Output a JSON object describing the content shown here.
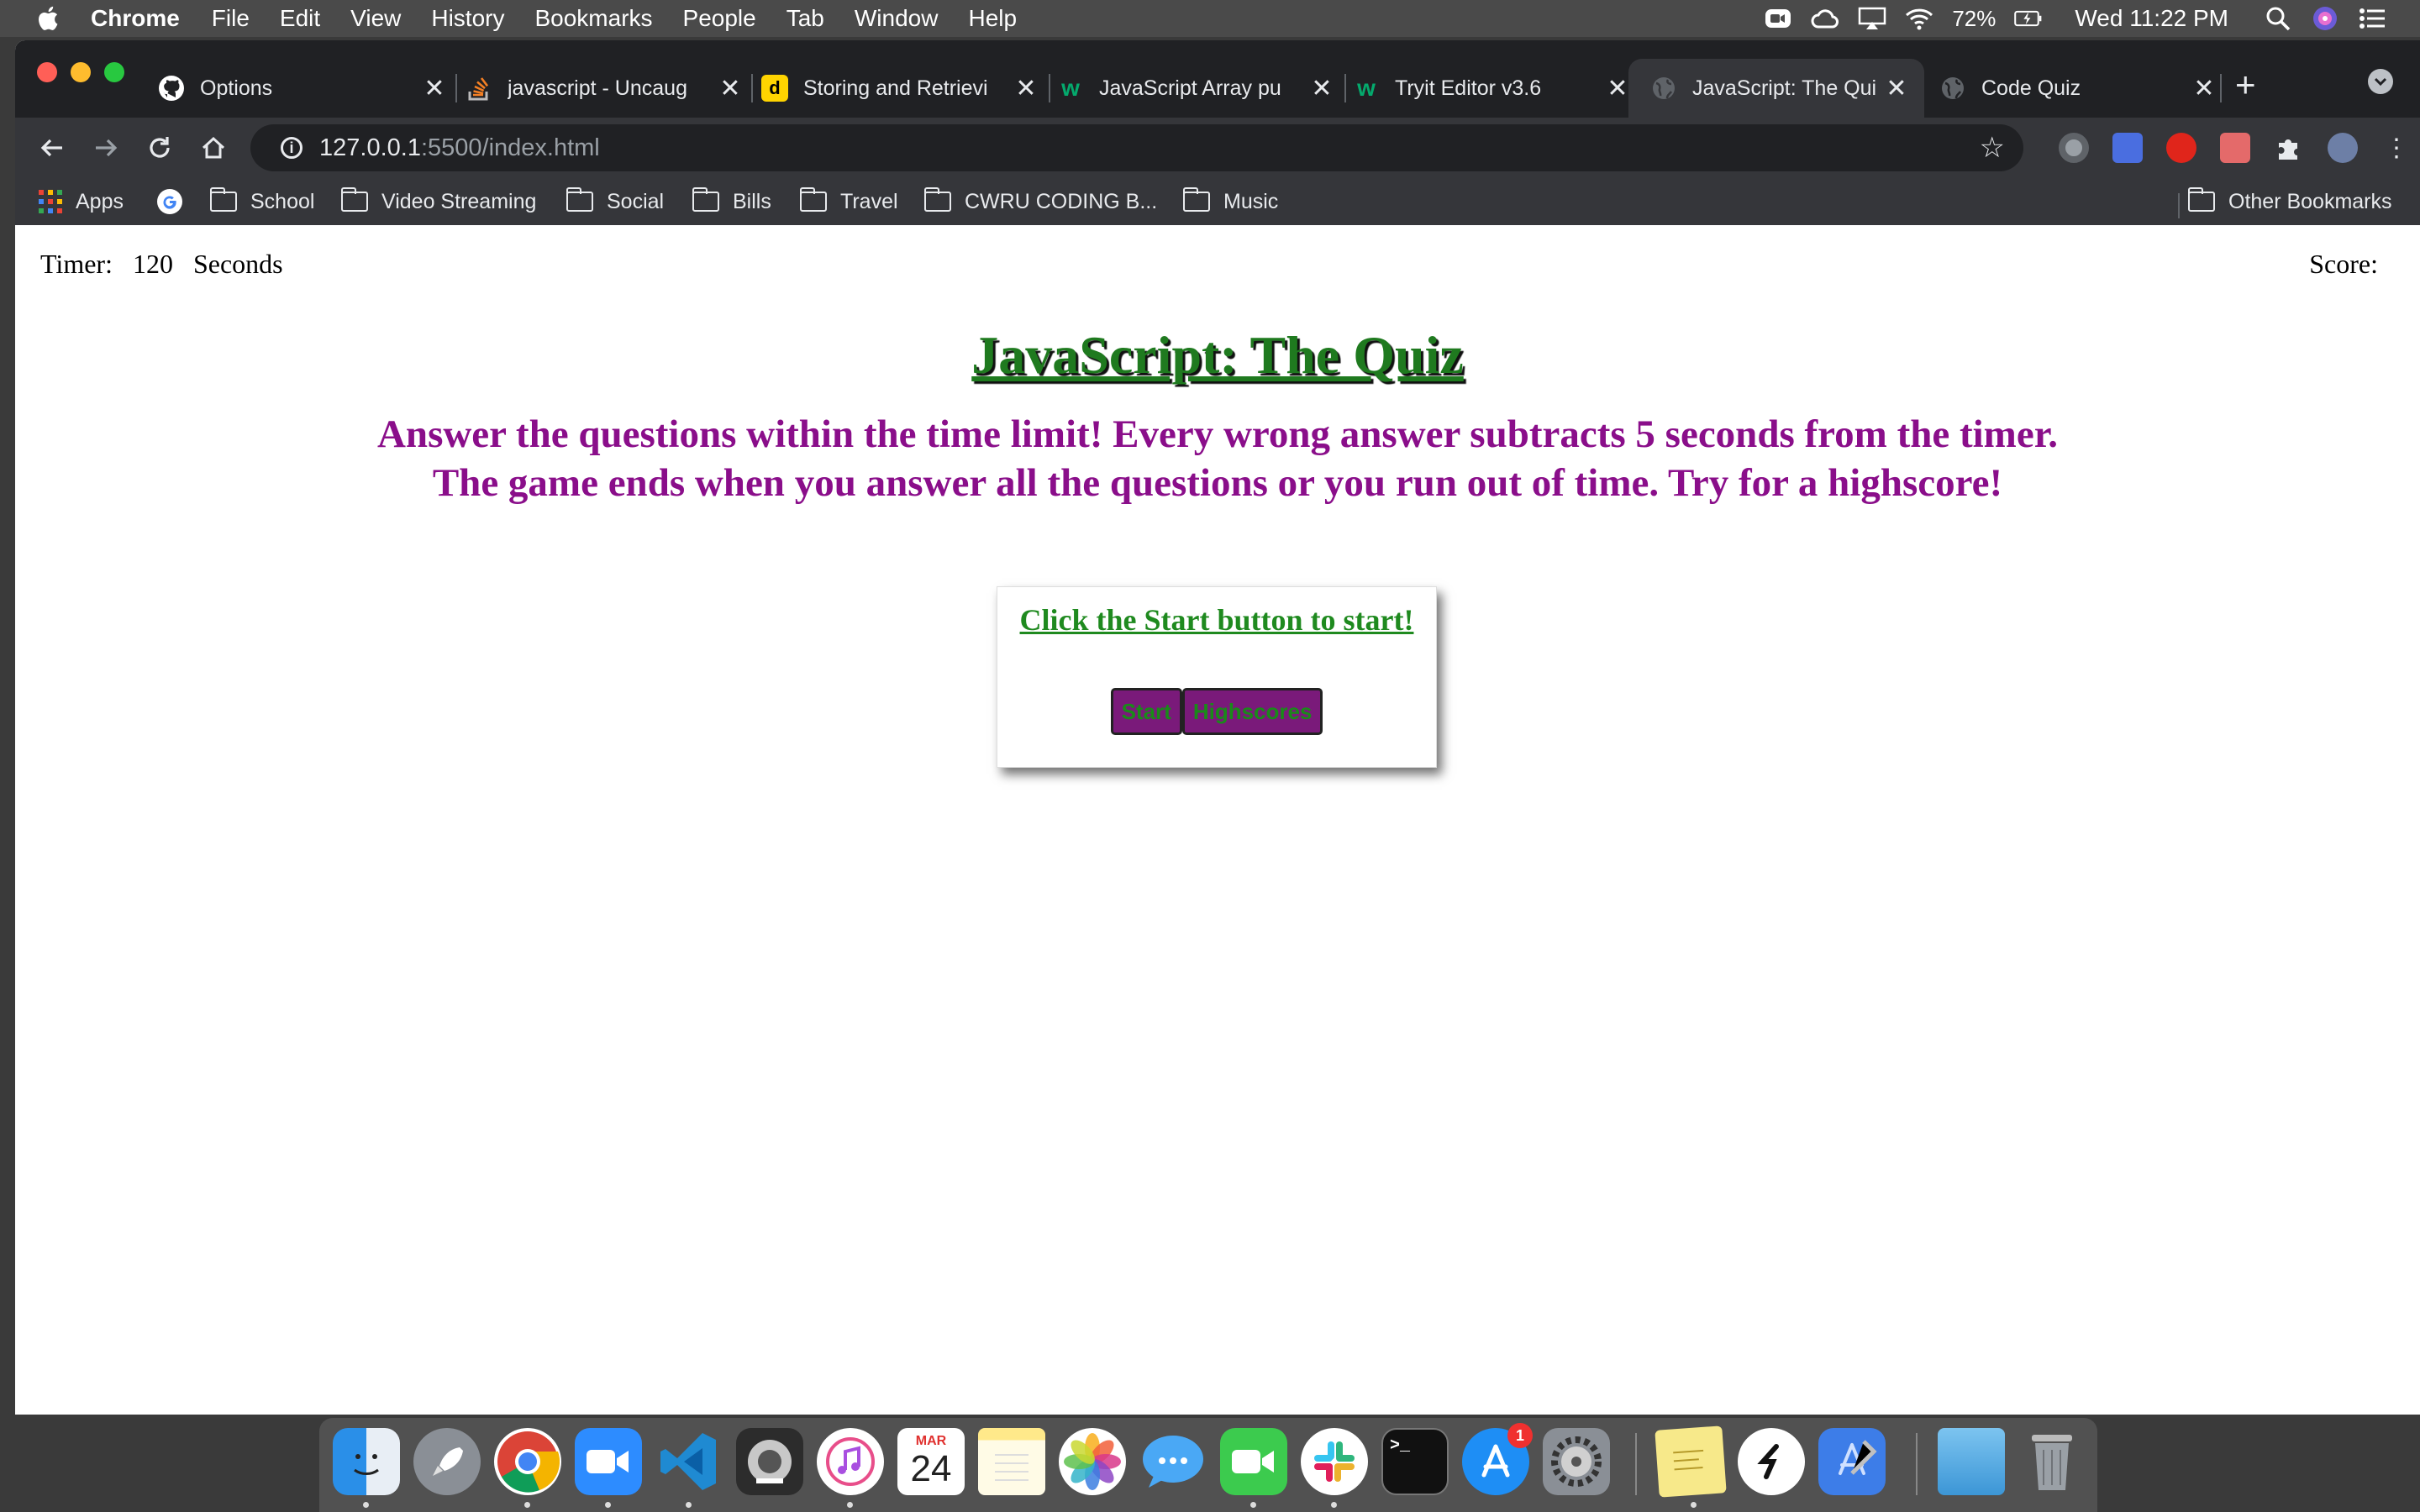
{
  "menubar": {
    "app": "Chrome",
    "items": [
      "File",
      "Edit",
      "View",
      "History",
      "Bookmarks",
      "People",
      "Tab",
      "Window",
      "Help"
    ],
    "battery": "72%",
    "clock": "Wed 11:22 PM"
  },
  "tabs": [
    {
      "title": "Options",
      "icon": "github-icon"
    },
    {
      "title": "javascript - Uncaug",
      "icon": "stackoverflow-icon"
    },
    {
      "title": "Storing and Retrievi",
      "icon": "dev-icon"
    },
    {
      "title": "JavaScript Array pu",
      "icon": "w3schools-icon"
    },
    {
      "title": "Tryit Editor v3.6",
      "icon": "w3schools-icon"
    },
    {
      "title": "JavaScript: The Qui",
      "icon": "globe-icon",
      "active": true
    },
    {
      "title": "Code Quiz",
      "icon": "globe-icon"
    }
  ],
  "address": {
    "host": "127.0.0.1",
    "rest": ":5500/index.html"
  },
  "bookmarks": {
    "apps": "Apps",
    "folders": [
      "School",
      "Video Streaming",
      "Social",
      "Bills",
      "Travel",
      "CWRU CODING B...",
      "Music"
    ],
    "other": "Other Bookmarks"
  },
  "page": {
    "timer_label": "Timer:",
    "timer_value": "120",
    "timer_unit": "Seconds",
    "score_label": "Score:",
    "title": "JavaScript: The Quiz",
    "subtitle_line1": "Answer the questions within the time limit! Every wrong answer subtracts 5 seconds from the timer.",
    "subtitle_line2": "The game ends when you answer all the questions or you run out of time. Try for a highscore!",
    "prompt": "Click the Start button to start!",
    "start_button": "Start",
    "highscores_button": "Highscores"
  },
  "dock": {
    "calendar_month": "MAR",
    "calendar_day": "24",
    "appstore_badge": "1"
  },
  "colors": {
    "title_green": "#1f7a1f",
    "subtitle_purple": "#8a0e8a",
    "button_purple": "#7a1a7a"
  }
}
